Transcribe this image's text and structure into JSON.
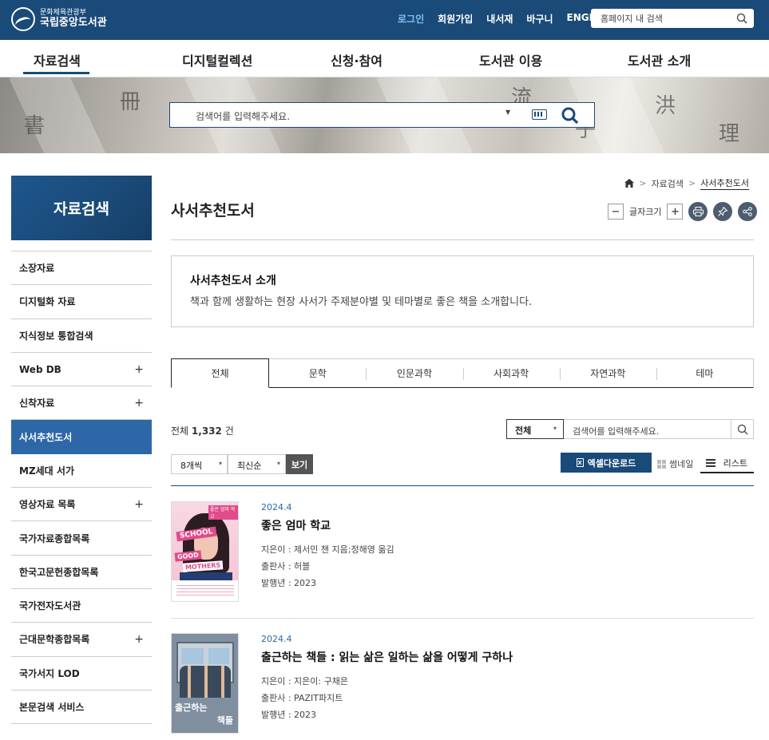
{
  "header": {
    "logo_sub": "문화체육관광부",
    "logo_main": "국립중앙도서관",
    "utils": [
      "로그인",
      "회원가입",
      "내서재",
      "바구니",
      "ENGLISH"
    ],
    "site_search_placeholder": "홈페이지 내 검색"
  },
  "gnb": [
    "자료검색",
    "디지털컬렉션",
    "신청·참여",
    "도서관 이용",
    "도서관 소개"
  ],
  "main_search": {
    "placeholder": "검색어를 입력해주세요."
  },
  "sidebar": {
    "title": "자료검색",
    "items": [
      {
        "label": "소장자료",
        "expandable": false
      },
      {
        "label": "디지털화 자료",
        "expandable": false
      },
      {
        "label": "지식정보 통합검색",
        "expandable": false
      },
      {
        "label": "Web DB",
        "expandable": true
      },
      {
        "label": "신착자료",
        "expandable": true
      },
      {
        "label": "사서추천도서",
        "expandable": false,
        "active": true
      },
      {
        "label": "MZ세대 서가",
        "expandable": false
      },
      {
        "label": "영상자료 목록",
        "expandable": true
      },
      {
        "label": "국가자료종합목록",
        "expandable": false
      },
      {
        "label": "한국고문헌종합목록",
        "expandable": false
      },
      {
        "label": "국가전자도서관",
        "expandable": false
      },
      {
        "label": "근대문학종합목록",
        "expandable": true
      },
      {
        "label": "국가서지 LOD",
        "expandable": false
      },
      {
        "label": "본문검색 서비스",
        "expandable": false
      }
    ],
    "plus_glyph": "+"
  },
  "breadcrumb": {
    "items": [
      "자료검색",
      "사서추천도서"
    ],
    "sep": ">"
  },
  "page_title": "사서추천도서",
  "tools": {
    "minus": "−",
    "font_size_label": "글자크기",
    "plus": "+"
  },
  "intro": {
    "title": "사서추천도서 소개",
    "text": "책과 함께 생활하는 현장 사서가 주제분야별 및 테마별로 좋은 책을 소개합니다."
  },
  "tabs": [
    "전체",
    "문학",
    "인문과학",
    "사회과학",
    "자연과학",
    "테마"
  ],
  "results": {
    "total_prefix": "전체",
    "total_count": "1,332",
    "total_suffix": "건",
    "filter_select": "전체",
    "filter_placeholder": "검색어를 입력해주세요.",
    "per_page": "8개씩",
    "sort": "최신순",
    "view_button": "보기",
    "excel_button": "엑셀다운로드",
    "excel_icon": "X",
    "thumbnail_label": "썸네일",
    "list_label": "리스트"
  },
  "books": [
    {
      "date": "2024.4",
      "title": "좋은 엄마 학교",
      "author": "지은이 : 제서민 챈 지음;정해영 옮김",
      "publisher": "출판사 : 허블",
      "year": "발행년 : 2023",
      "cover": {
        "top": "좋은 엄마 학교",
        "school": "SCHOOL",
        "good": "GOOD",
        "mothers": "MOTHERS"
      }
    },
    {
      "date": "2024.4",
      "title": "출근하는 책들 : 읽는 삶은 일하는 삶을 어떻게 구하나",
      "author": "지은이 : 지은이: 구채은",
      "publisher": "출판사 : PAZIT파지트",
      "year": "발행년 : 2023",
      "cover": {
        "line1": "출근하는",
        "line2": "책들"
      }
    }
  ],
  "colors": {
    "navy": "#1a4a78",
    "active_side": "#2d67a8",
    "login": "#7fc3f4"
  }
}
